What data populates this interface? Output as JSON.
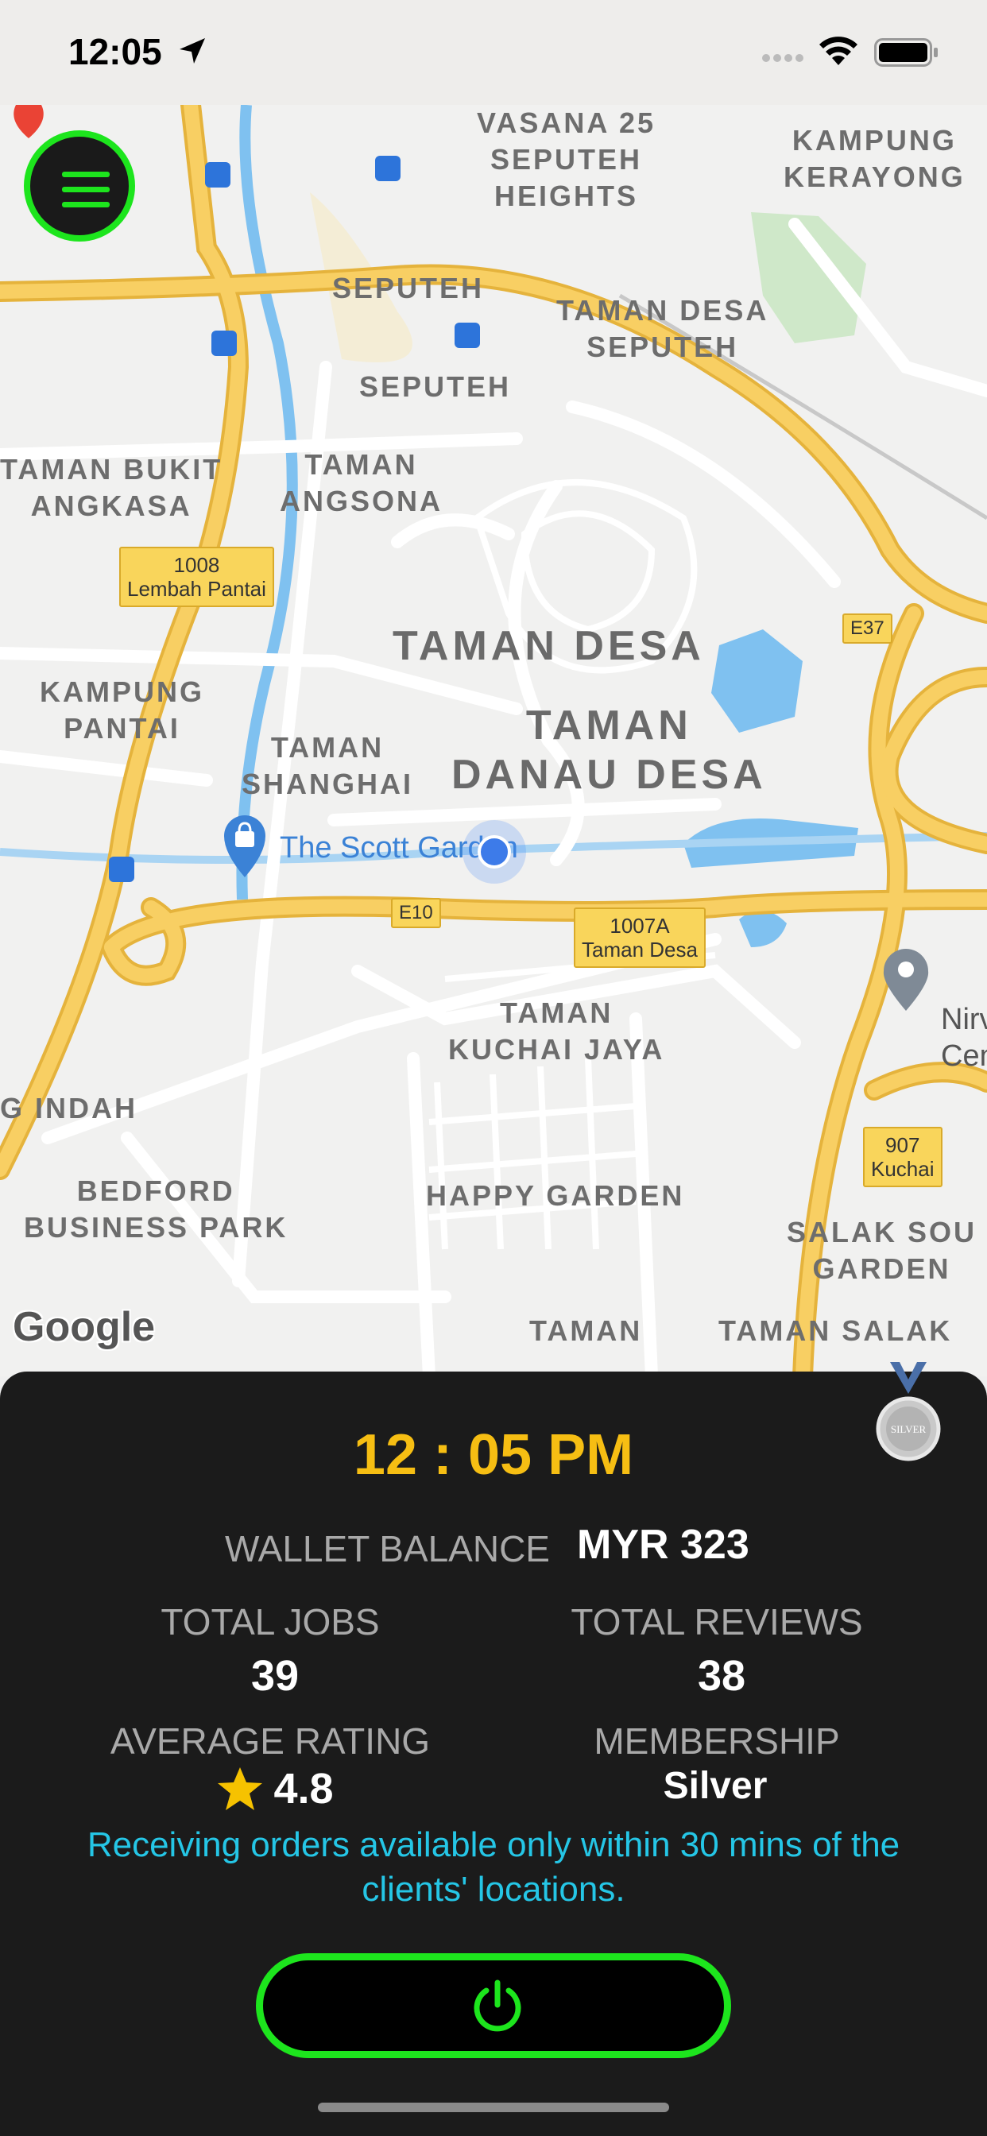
{
  "status_bar": {
    "time": "12:05",
    "icons": [
      "location-arrow-icon",
      "cellular-signal-icon",
      "wifi-icon",
      "battery-icon"
    ]
  },
  "map": {
    "labels": {
      "vasana": "VASANA 25\nSEPUTEH\nHEIGHTS",
      "kampung_kerayong": "KAMPUNG\nKERAYONG",
      "seputeh_1": "SEPUTEH",
      "taman_desa_seputeh": "TAMAN DESA\nSEPUTEH",
      "seputeh_2": "SEPUTEH",
      "taman_bukit_angkasa": "TAMAN BUKIT\nANGKASA",
      "taman_angsona": "TAMAN\nANGSONA",
      "taman_desa": "TAMAN DESA",
      "taman_danau_desa": "TAMAN\nDANAU DESA",
      "kampung_pantai": "KAMPUNG\nPANTAI",
      "taman_shanghai": "TAMAN\nSHANGHAI",
      "taman_kuchai_jaya": "TAMAN\nKUCHAI JAYA",
      "g_indah": "G INDAH",
      "bedford": "BEDFORD\nBUSINESS PARK",
      "happy_garden": "HAPPY GARDEN",
      "salak_south_garden": "SALAK SOU\nGARDEN",
      "taman_bottom": "TAMAN",
      "taman_salak": "TAMAN SALAK"
    },
    "poi": {
      "scott_garden": "The Scott Garden",
      "nirv": "Nirv\nCen"
    },
    "shields": {
      "s1008": "1008\nLembah Pantai",
      "e37": "E37",
      "e10": "E10",
      "s1007a": "1007A\nTaman Desa",
      "s907": "907\nKuchai"
    },
    "attribution": "Google",
    "colors": {
      "road_major": "#f8cf63",
      "road_major_border": "#e5b33c",
      "road_minor": "#ffffff",
      "water": "#7fc1f0",
      "park": "#cfe8c9",
      "land": "#efefef"
    }
  },
  "panel": {
    "time": "12 : 05 PM",
    "wallet_label": "WALLET BALANCE",
    "wallet_value": "MYR 323",
    "total_jobs_label": "TOTAL JOBS",
    "total_jobs_value": "39",
    "total_reviews_label": "TOTAL REVIEWS",
    "total_reviews_value": "38",
    "average_rating_label": "AVERAGE RATING",
    "average_rating_value": "4.8",
    "membership_label": "MEMBERSHIP",
    "membership_value": "Silver",
    "medal_text": "SILVER",
    "notice": "Receiving orders available only within 30 mins of the clients' locations.",
    "colors": {
      "accent_green": "#1de51d",
      "time_yellow": "#f6be13",
      "notice_cyan": "#25c6e6",
      "panel_bg": "#1b1b1b"
    }
  }
}
